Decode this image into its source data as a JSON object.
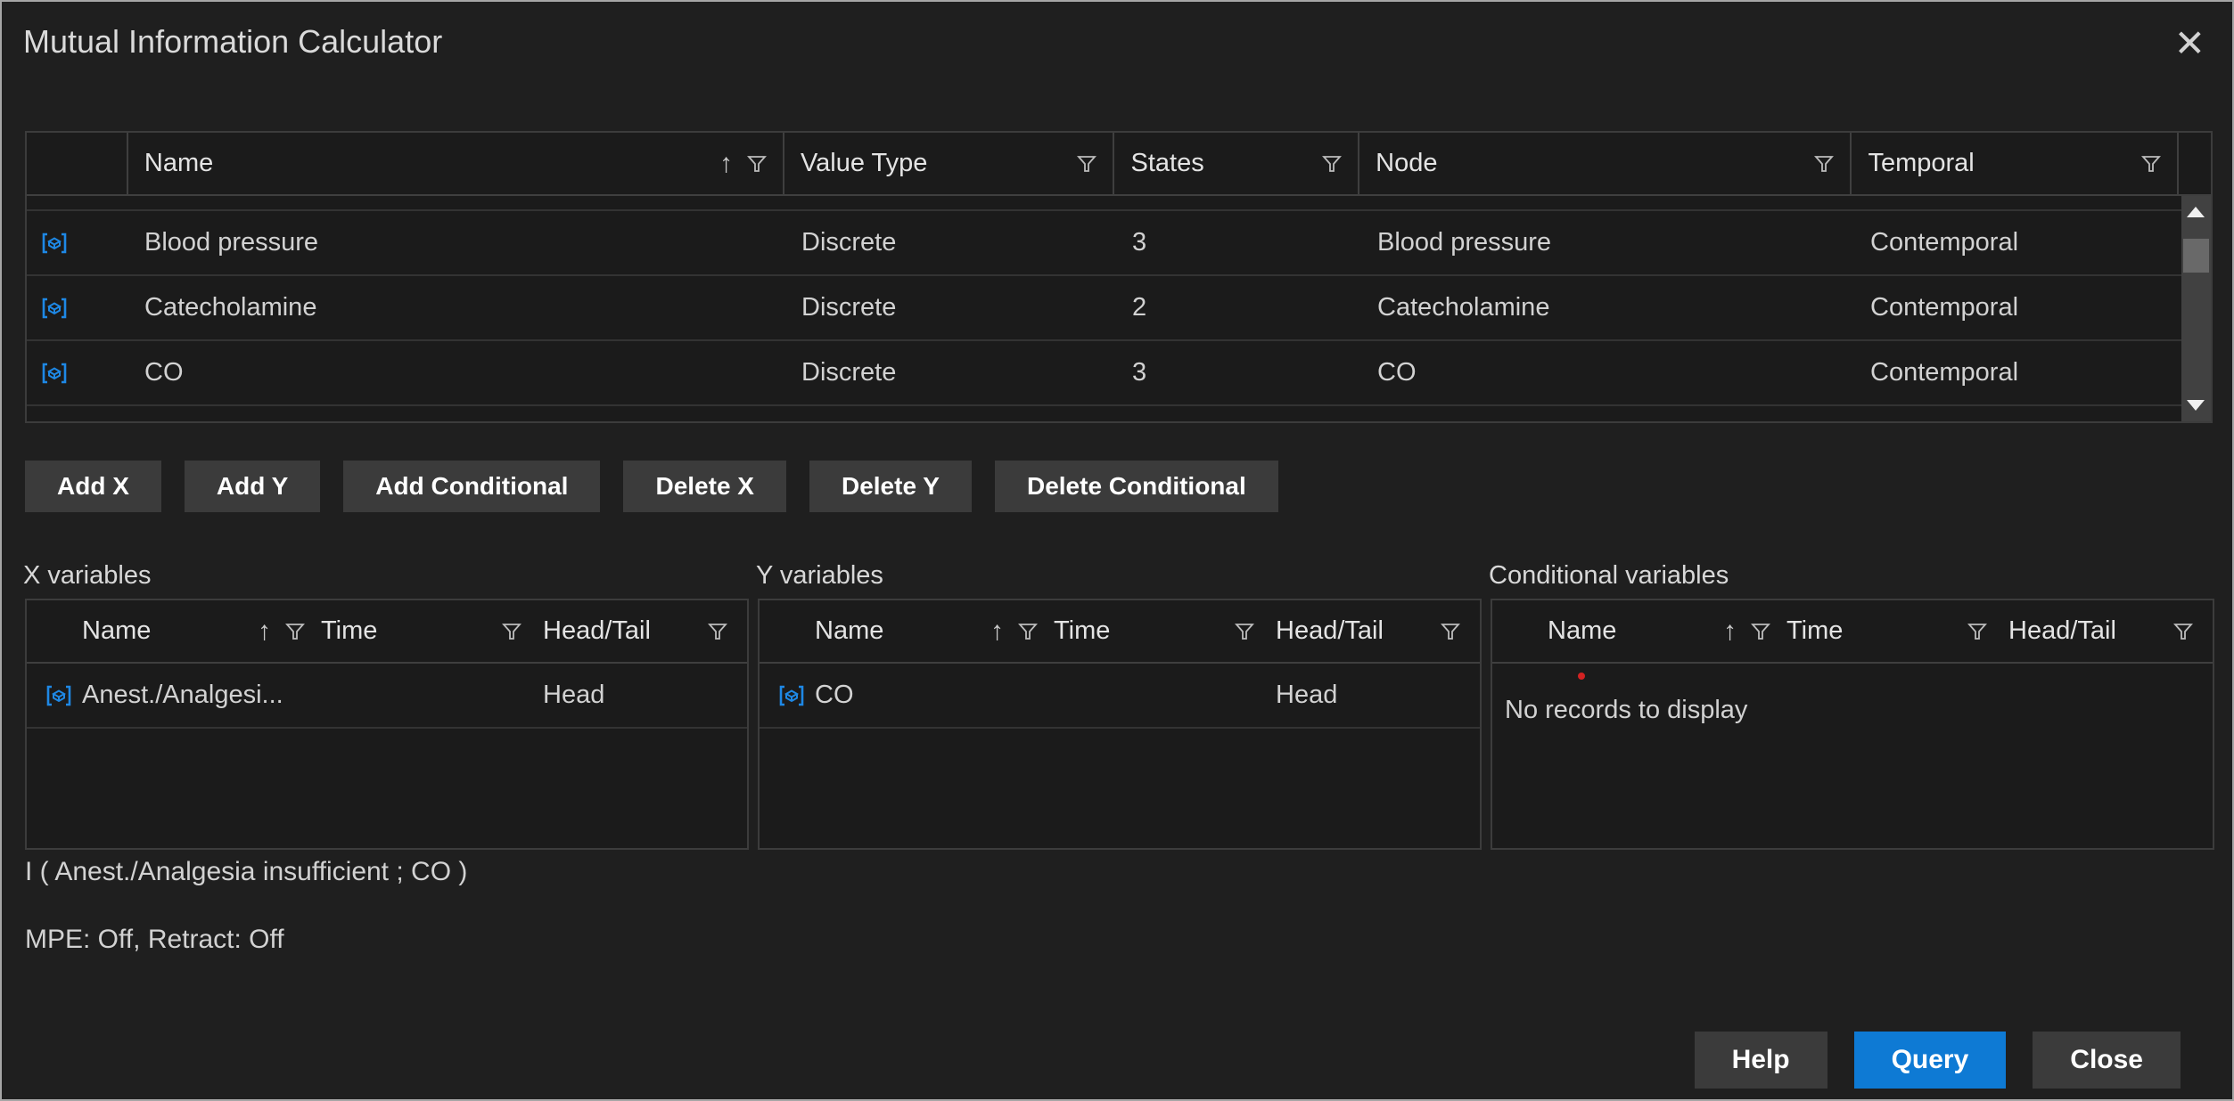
{
  "window": {
    "title": "Mutual Information Calculator",
    "close_glyph": "✕"
  },
  "colors": {
    "accent_blue": "#0e7ad4",
    "icon_blue": "#1e88e5",
    "red_dot": "#d32222",
    "window_bg": "#1f1f1f",
    "table_bg": "#1b1b1b",
    "border": "#3c3c3c"
  },
  "main_table": {
    "columns": [
      {
        "label": ""
      },
      {
        "label": "Name",
        "sort": "asc",
        "filter": true
      },
      {
        "label": "Value Type",
        "filter": true
      },
      {
        "label": "States",
        "filter": true
      },
      {
        "label": "Node",
        "filter": true
      },
      {
        "label": "Temporal",
        "filter": true
      }
    ],
    "rows": [
      {
        "name": "Blood pressure",
        "value_type": "Discrete",
        "states": "3",
        "node": "Blood pressure",
        "temporal": "Contemporal"
      },
      {
        "name": "Catecholamine",
        "value_type": "Discrete",
        "states": "2",
        "node": "Catecholamine",
        "temporal": "Contemporal"
      },
      {
        "name": "CO",
        "value_type": "Discrete",
        "states": "3",
        "node": "CO",
        "temporal": "Contemporal"
      }
    ]
  },
  "action_buttons": {
    "add_x": "Add X",
    "add_y": "Add Y",
    "add_conditional": "Add Conditional",
    "delete_x": "Delete X",
    "delete_y": "Delete Y",
    "delete_conditional": "Delete Conditional"
  },
  "panels": [
    {
      "title": "X variables",
      "columns": [
        "Name",
        "Time",
        "Head/Tail"
      ],
      "rows": [
        {
          "name": "Anest./Analgesi...",
          "time": "",
          "head_tail": "Head"
        }
      ]
    },
    {
      "title": "Y variables",
      "columns": [
        "Name",
        "Time",
        "Head/Tail"
      ],
      "rows": [
        {
          "name": "CO",
          "time": "",
          "head_tail": "Head"
        }
      ]
    },
    {
      "title": "Conditional variables",
      "columns": [
        "Name",
        "Time",
        "Head/Tail"
      ],
      "rows": [],
      "empty_text": "No records to display"
    }
  ],
  "summary": {
    "expression": "I ( Anest./Analgesia insufficient ; CO )",
    "options": "MPE: Off, Retract: Off"
  },
  "footer": {
    "help": "Help",
    "query": "Query",
    "close": "Close"
  }
}
